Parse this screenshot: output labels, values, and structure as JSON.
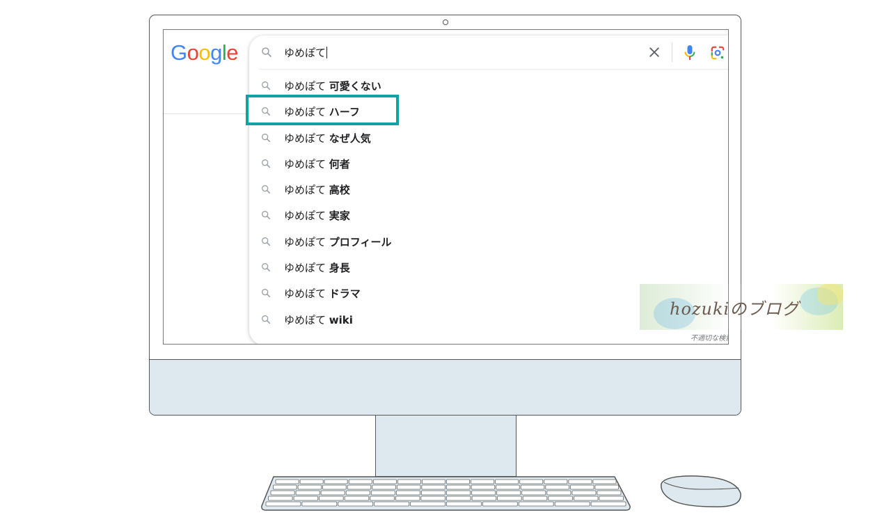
{
  "google_logo": [
    "G",
    "o",
    "o",
    "g",
    "l",
    "e"
  ],
  "search": {
    "query": "ゆめぽて"
  },
  "suggestions": [
    {
      "prefix": "ゆめぽて",
      "completion": "可愛くない"
    },
    {
      "prefix": "ゆめぽて",
      "completion": "ハーフ"
    },
    {
      "prefix": "ゆめぽて",
      "completion": "なぜ人気"
    },
    {
      "prefix": "ゆめぽて",
      "completion": "何者"
    },
    {
      "prefix": "ゆめぽて",
      "completion": "高校"
    },
    {
      "prefix": "ゆめぽて",
      "completion": "実家"
    },
    {
      "prefix": "ゆめぽて",
      "completion": "プロフィール"
    },
    {
      "prefix": "ゆめぽて",
      "completion": "身長"
    },
    {
      "prefix": "ゆめぽて",
      "completion": "ドラマ"
    },
    {
      "prefix": "ゆめぽて",
      "completion": "wiki"
    }
  ],
  "report_link": "不適切な検索候補",
  "watermark": "hozukiのブログ",
  "highlighted_suggestion_index": 1,
  "colors": {
    "highlight": "#13a1a4",
    "google_blue": "#4285f4",
    "google_red": "#ea4335",
    "google_yellow": "#fbbc05",
    "google_green": "#34a853",
    "monitor_body": "#dde9ee"
  },
  "icons": [
    "search-icon",
    "clear-icon",
    "mic-icon",
    "google-lens-icon"
  ]
}
